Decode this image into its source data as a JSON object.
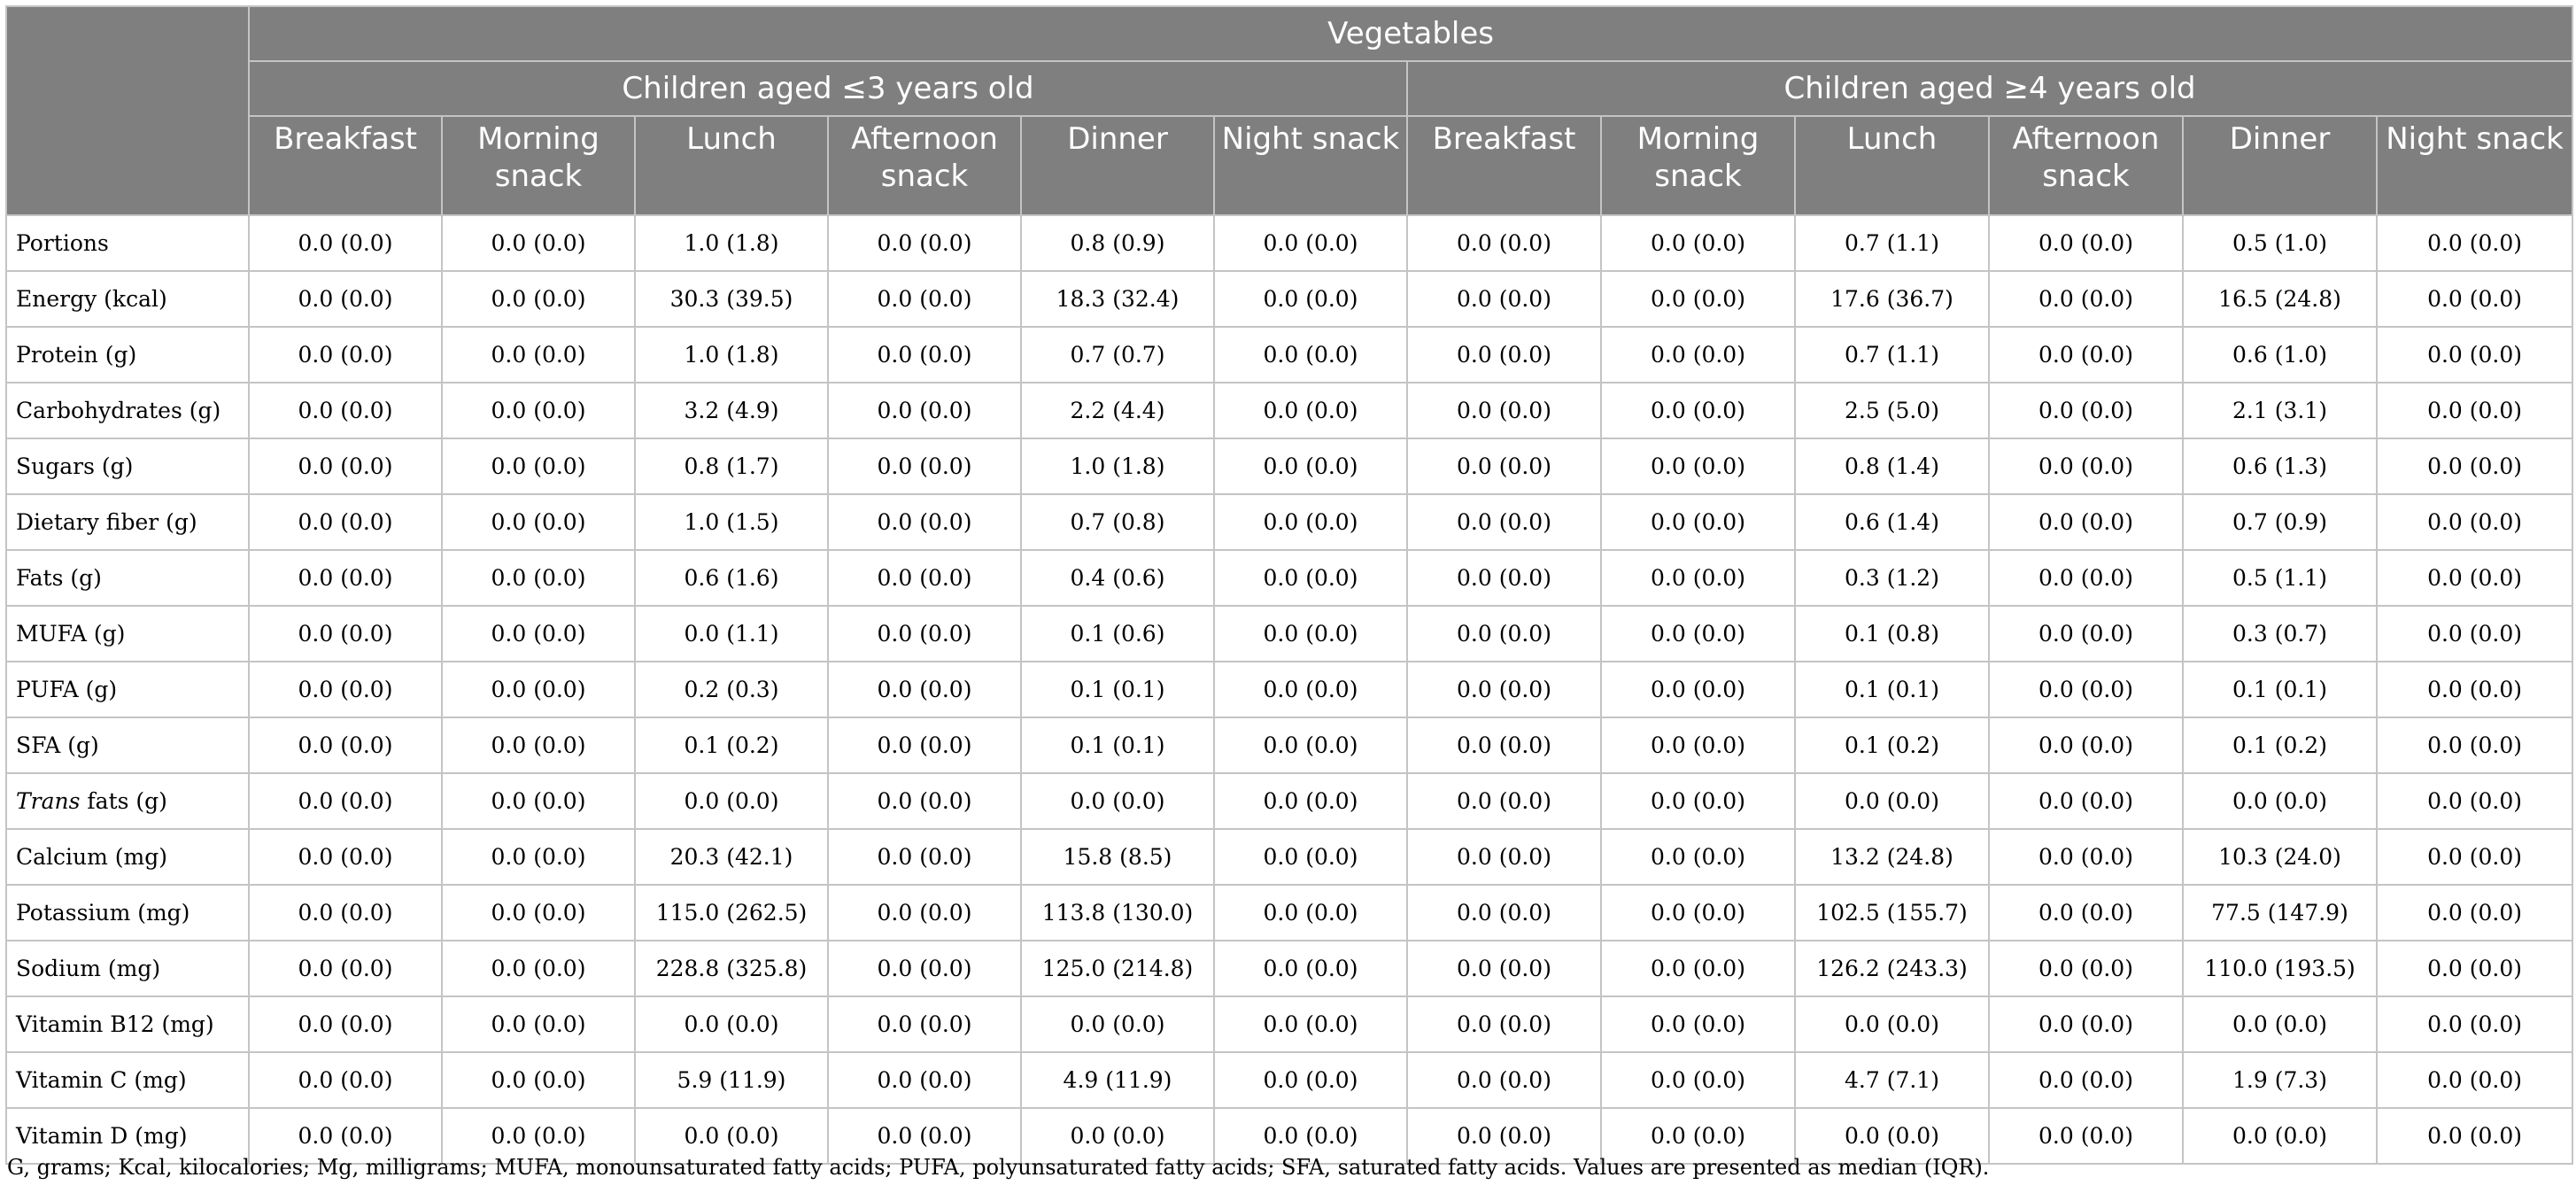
{
  "table": {
    "group_header": "Vegetables",
    "age_groups": [
      "Children aged ≤3 years old",
      "Children aged ≥4 years old"
    ],
    "meals": [
      "Breakfast",
      "Morning snack",
      "Lunch",
      "Afternoon snack",
      "Dinner",
      "Night snack"
    ],
    "rows": [
      {
        "label": "Portions",
        "italic_prefix": "",
        "label_rest": "Portions",
        "cells": [
          "0.0 (0.0)",
          "0.0 (0.0)",
          "1.0 (1.8)",
          "0.0 (0.0)",
          "0.8 (0.9)",
          "0.0 (0.0)",
          "0.0 (0.0)",
          "0.0 (0.0)",
          "0.7 (1.1)",
          "0.0 (0.0)",
          "0.5 (1.0)",
          "0.0 (0.0)"
        ]
      },
      {
        "label": "Energy (kcal)",
        "italic_prefix": "",
        "label_rest": "Energy (kcal)",
        "cells": [
          "0.0 (0.0)",
          "0.0 (0.0)",
          "30.3 (39.5)",
          "0.0 (0.0)",
          "18.3 (32.4)",
          "0.0 (0.0)",
          "0.0 (0.0)",
          "0.0 (0.0)",
          "17.6 (36.7)",
          "0.0 (0.0)",
          "16.5 (24.8)",
          "0.0 (0.0)"
        ]
      },
      {
        "label": "Protein (g)",
        "italic_prefix": "",
        "label_rest": "Protein (g)",
        "cells": [
          "0.0 (0.0)",
          "0.0 (0.0)",
          "1.0 (1.8)",
          "0.0 (0.0)",
          "0.7 (0.7)",
          "0.0 (0.0)",
          "0.0 (0.0)",
          "0.0 (0.0)",
          "0.7 (1.1)",
          "0.0 (0.0)",
          "0.6 (1.0)",
          "0.0 (0.0)"
        ]
      },
      {
        "label": "Carbohydrates (g)",
        "italic_prefix": "",
        "label_rest": "Carbohydrates (g)",
        "cells": [
          "0.0 (0.0)",
          "0.0 (0.0)",
          "3.2 (4.9)",
          "0.0 (0.0)",
          "2.2 (4.4)",
          "0.0 (0.0)",
          "0.0 (0.0)",
          "0.0 (0.0)",
          "2.5 (5.0)",
          "0.0 (0.0)",
          "2.1 (3.1)",
          "0.0 (0.0)"
        ]
      },
      {
        "label": "Sugars (g)",
        "italic_prefix": "",
        "label_rest": "Sugars (g)",
        "cells": [
          "0.0 (0.0)",
          "0.0 (0.0)",
          "0.8 (1.7)",
          "0.0 (0.0)",
          "1.0 (1.8)",
          "0.0 (0.0)",
          "0.0 (0.0)",
          "0.0 (0.0)",
          "0.8 (1.4)",
          "0.0 (0.0)",
          "0.6 (1.3)",
          "0.0 (0.0)"
        ]
      },
      {
        "label": "Dietary fiber (g)",
        "italic_prefix": "",
        "label_rest": "Dietary fiber (g)",
        "cells": [
          "0.0 (0.0)",
          "0.0 (0.0)",
          "1.0 (1.5)",
          "0.0 (0.0)",
          "0.7 (0.8)",
          "0.0 (0.0)",
          "0.0 (0.0)",
          "0.0 (0.0)",
          "0.6 (1.4)",
          "0.0 (0.0)",
          "0.7 (0.9)",
          "0.0 (0.0)"
        ]
      },
      {
        "label": "Fats (g)",
        "italic_prefix": "",
        "label_rest": "Fats (g)",
        "cells": [
          "0.0 (0.0)",
          "0.0 (0.0)",
          "0.6 (1.6)",
          "0.0 (0.0)",
          "0.4 (0.6)",
          "0.0 (0.0)",
          "0.0 (0.0)",
          "0.0 (0.0)",
          "0.3 (1.2)",
          "0.0 (0.0)",
          "0.5 (1.1)",
          "0.0 (0.0)"
        ]
      },
      {
        "label": "MUFA (g)",
        "italic_prefix": "",
        "label_rest": "MUFA (g)",
        "cells": [
          "0.0 (0.0)",
          "0.0 (0.0)",
          "0.0 (1.1)",
          "0.0 (0.0)",
          "0.1 (0.6)",
          "0.0 (0.0)",
          "0.0 (0.0)",
          "0.0 (0.0)",
          "0.1 (0.8)",
          "0.0 (0.0)",
          "0.3 (0.7)",
          "0.0 (0.0)"
        ]
      },
      {
        "label": "PUFA (g)",
        "italic_prefix": "",
        "label_rest": "PUFA (g)",
        "cells": [
          "0.0 (0.0)",
          "0.0 (0.0)",
          "0.2 (0.3)",
          "0.0 (0.0)",
          "0.1 (0.1)",
          "0.0 (0.0)",
          "0.0 (0.0)",
          "0.0 (0.0)",
          "0.1 (0.1)",
          "0.0 (0.0)",
          "0.1 (0.1)",
          "0.0 (0.0)"
        ]
      },
      {
        "label": "SFA (g)",
        "italic_prefix": "",
        "label_rest": "SFA (g)",
        "cells": [
          "0.0 (0.0)",
          "0.0 (0.0)",
          "0.1 (0.2)",
          "0.0 (0.0)",
          "0.1 (0.1)",
          "0.0 (0.0)",
          "0.0 (0.0)",
          "0.0 (0.0)",
          "0.1 (0.2)",
          "0.0 (0.0)",
          "0.1 (0.2)",
          "0.0 (0.0)"
        ]
      },
      {
        "label": "Trans fats (g)",
        "italic_prefix": "Trans",
        "label_rest": " fats (g)",
        "cells": [
          "0.0 (0.0)",
          "0.0 (0.0)",
          "0.0 (0.0)",
          "0.0 (0.0)",
          "0.0 (0.0)",
          "0.0 (0.0)",
          "0.0 (0.0)",
          "0.0 (0.0)",
          "0.0 (0.0)",
          "0.0 (0.0)",
          "0.0 (0.0)",
          "0.0 (0.0)"
        ]
      },
      {
        "label": "Calcium (mg)",
        "italic_prefix": "",
        "label_rest": "Calcium (mg)",
        "cells": [
          "0.0 (0.0)",
          "0.0 (0.0)",
          "20.3 (42.1)",
          "0.0 (0.0)",
          "15.8 (8.5)",
          "0.0 (0.0)",
          "0.0 (0.0)",
          "0.0 (0.0)",
          "13.2 (24.8)",
          "0.0 (0.0)",
          "10.3 (24.0)",
          "0.0 (0.0)"
        ]
      },
      {
        "label": "Potassium (mg)",
        "italic_prefix": "",
        "label_rest": "Potassium (mg)",
        "cells": [
          "0.0 (0.0)",
          "0.0 (0.0)",
          "115.0 (262.5)",
          "0.0 (0.0)",
          "113.8 (130.0)",
          "0.0 (0.0)",
          "0.0 (0.0)",
          "0.0 (0.0)",
          "102.5 (155.7)",
          "0.0 (0.0)",
          "77.5 (147.9)",
          "0.0 (0.0)"
        ]
      },
      {
        "label": "Sodium (mg)",
        "italic_prefix": "",
        "label_rest": "Sodium (mg)",
        "cells": [
          "0.0 (0.0)",
          "0.0 (0.0)",
          "228.8 (325.8)",
          "0.0 (0.0)",
          "125.0 (214.8)",
          "0.0 (0.0)",
          "0.0 (0.0)",
          "0.0 (0.0)",
          "126.2 (243.3)",
          "0.0 (0.0)",
          "110.0 (193.5)",
          "0.0 (0.0)"
        ]
      },
      {
        "label": "Vitamin B12 (mg)",
        "italic_prefix": "",
        "label_rest": "Vitamin B12 (mg)",
        "cells": [
          "0.0 (0.0)",
          "0.0 (0.0)",
          "0.0 (0.0)",
          "0.0 (0.0)",
          "0.0 (0.0)",
          "0.0 (0.0)",
          "0.0 (0.0)",
          "0.0 (0.0)",
          "0.0 (0.0)",
          "0.0 (0.0)",
          "0.0 (0.0)",
          "0.0 (0.0)"
        ]
      },
      {
        "label": "Vitamin C (mg)",
        "italic_prefix": "",
        "label_rest": "Vitamin C (mg)",
        "cells": [
          "0.0 (0.0)",
          "0.0 (0.0)",
          "5.9 (11.9)",
          "0.0 (0.0)",
          "4.9 (11.9)",
          "0.0 (0.0)",
          "0.0 (0.0)",
          "0.0 (0.0)",
          "4.7 (7.1)",
          "0.0 (0.0)",
          "1.9 (7.3)",
          "0.0 (0.0)"
        ]
      },
      {
        "label": "Vitamin D (mg)",
        "italic_prefix": "",
        "label_rest": "Vitamin D (mg)",
        "cells": [
          "0.0 (0.0)",
          "0.0 (0.0)",
          "0.0 (0.0)",
          "0.0 (0.0)",
          "0.0 (0.0)",
          "0.0 (0.0)",
          "0.0 (0.0)",
          "0.0 (0.0)",
          "0.0 (0.0)",
          "0.0 (0.0)",
          "0.0 (0.0)",
          "0.0 (0.0)"
        ]
      }
    ]
  },
  "footnote": "G, grams; Kcal, kilocalories; Mg, milligrams; MUFA, monounsaturated fatty acids; PUFA, polyunsaturated fatty acids; SFA, saturated fatty acids. Values are presented as median (IQR).",
  "colors": {
    "header_bg": "#7f7f7f",
    "header_text": "#ffffff",
    "grid": "#c4c4c4",
    "body_text": "#000000"
  }
}
